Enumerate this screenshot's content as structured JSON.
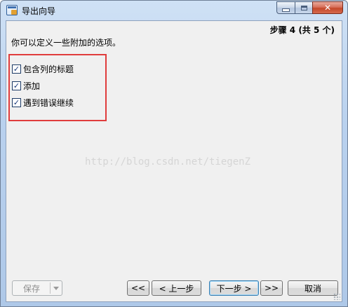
{
  "window": {
    "title": "导出向导"
  },
  "wizard": {
    "step_indicator": "步骤 4 (共 5 个)",
    "description": "你可以定义一些附加的选项。",
    "options": [
      {
        "label": "包含列的标题",
        "checked": true
      },
      {
        "label": "添加",
        "checked": true
      },
      {
        "label": "遇到错误继续",
        "checked": true
      }
    ]
  },
  "watermark": "http://blog.csdn.net/tiegenZ",
  "footer": {
    "save_label": "保存",
    "first_label": "<<",
    "prev_label": "< 上一步",
    "next_label": "下一步 >",
    "last_label": ">>",
    "cancel_label": "取消"
  },
  "colors": {
    "highlight_border": "#e03c3c",
    "client_bg": "#f0f0f0",
    "frame": "#b9d1ee"
  }
}
